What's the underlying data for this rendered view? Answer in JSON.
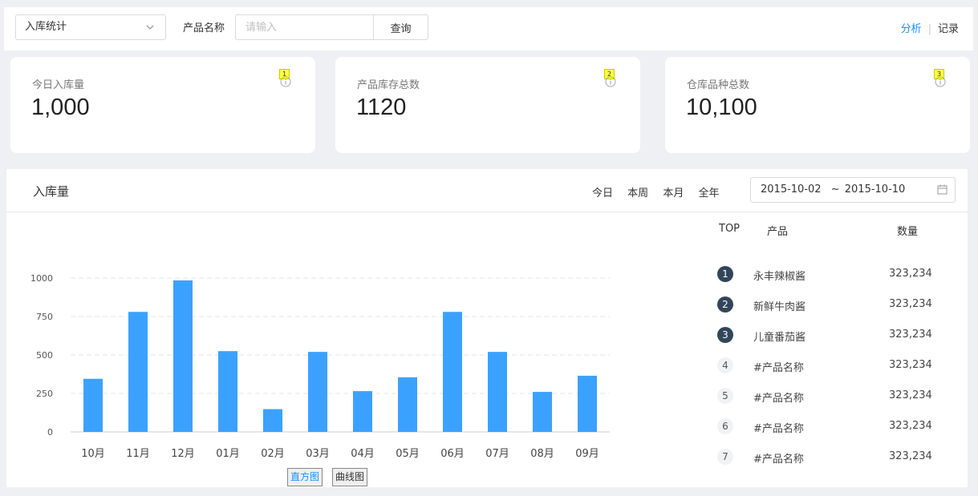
{
  "toolbar": {
    "select_value": "入库统计",
    "field_label": "产品名称",
    "search_placeholder": "请输入",
    "search_button": "查询",
    "nav_active": "分析",
    "nav_other": "记录"
  },
  "cards": [
    {
      "label": "今日入库量",
      "value": "1,000",
      "badge": "1"
    },
    {
      "label": "产品库存总数",
      "value": "1120",
      "badge": "2"
    },
    {
      "label": "仓库品种总数",
      "value": "10,100",
      "badge": "3"
    }
  ],
  "panel": {
    "title": "入库量",
    "periods": [
      "今日",
      "本周",
      "本月",
      "全年"
    ],
    "date_start": "2015-10-02",
    "date_sep": "~",
    "date_end": "2015-10-10",
    "tab_bar": "直方图",
    "tab_line": "曲线图"
  },
  "chart_data": {
    "type": "bar",
    "categories": [
      "10月",
      "11月",
      "12月",
      "01月",
      "02月",
      "03月",
      "04月",
      "05月",
      "06月",
      "07月",
      "08月",
      "09月"
    ],
    "values": [
      345,
      780,
      985,
      525,
      148,
      520,
      265,
      355,
      780,
      520,
      260,
      365
    ],
    "yticks": [
      0,
      250,
      500,
      750,
      1000
    ],
    "ylim": [
      0,
      1000
    ],
    "grid": true,
    "bar_color": "#3ba1ff"
  },
  "ranking": {
    "headers": {
      "top": "TOP",
      "product": "产品",
      "qty": "数量"
    },
    "rows": [
      {
        "rank": "1",
        "name": "永丰辣椒酱",
        "value": "323,234"
      },
      {
        "rank": "2",
        "name": "新鲜牛肉酱",
        "value": "323,234"
      },
      {
        "rank": "3",
        "name": "儿童番茄酱",
        "value": "323,234"
      },
      {
        "rank": "4",
        "name": "#产品名称",
        "value": "323,234"
      },
      {
        "rank": "5",
        "name": "#产品名称",
        "value": "323,234"
      },
      {
        "rank": "6",
        "name": "#产品名称",
        "value": "323,234"
      },
      {
        "rank": "7",
        "name": "#产品名称",
        "value": "323,234"
      }
    ]
  }
}
